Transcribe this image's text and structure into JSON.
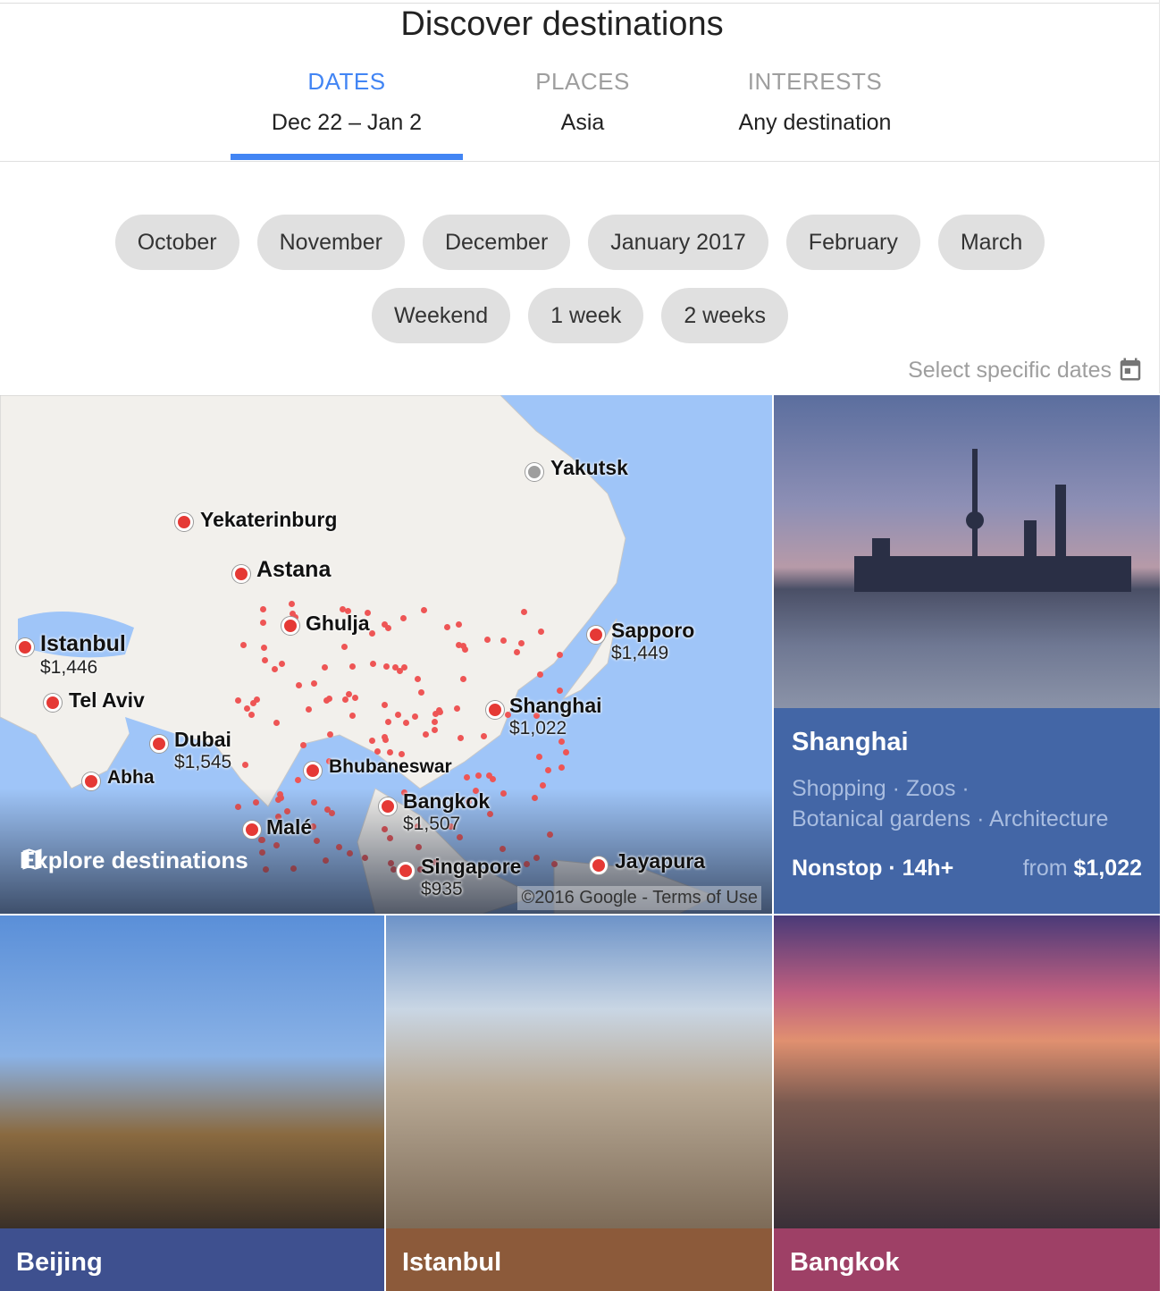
{
  "title": "Discover destinations",
  "tabs": [
    {
      "label": "DATES",
      "value": "Dec 22 – Jan 2",
      "active": true
    },
    {
      "label": "PLACES",
      "value": "Asia",
      "active": false
    },
    {
      "label": "INTERESTS",
      "value": "Any destination",
      "active": false
    }
  ],
  "months": [
    "October",
    "November",
    "December",
    "January 2017",
    "February",
    "March"
  ],
  "durations": [
    "Weekend",
    "1 week",
    "2 weeks"
  ],
  "select_dates": "Select specific dates",
  "map": {
    "pins": [
      {
        "name": "Yakutsk",
        "gray": true
      },
      {
        "name": "Yekaterinburg"
      },
      {
        "name": "Astana"
      },
      {
        "name": "Ghulja"
      },
      {
        "name": "Istanbul",
        "price": "$1,446"
      },
      {
        "name": "Sapporo",
        "price": "$1,449"
      },
      {
        "name": "Tel Aviv"
      },
      {
        "name": "Shanghai",
        "price": "$1,022"
      },
      {
        "name": "Dubai",
        "price": "$1,545"
      },
      {
        "name": "Bhubaneswar"
      },
      {
        "name": "Abha"
      },
      {
        "name": "Bangkok",
        "price": "$1,507"
      },
      {
        "name": "Malé"
      },
      {
        "name": "Singapore",
        "price": "$935"
      },
      {
        "name": "Jayapura"
      }
    ],
    "explore_label": "Explore destinations",
    "copyright": "©2016 Google - ",
    "terms": "Terms of Use"
  },
  "featured": {
    "name": "Shanghai",
    "tags_line1": "Shopping · Zoos ·",
    "tags_line2": "Botanical gardens · Architecture",
    "flight": "Nonstop · 14h+",
    "from": "from",
    "price": "$1,022",
    "color": "#4366a6"
  },
  "cards": [
    {
      "name": "Beijing",
      "color": "#3e508f"
    },
    {
      "name": "Istanbul",
      "color": "#8c5a3a"
    },
    {
      "name": "Bangkok",
      "color": "#9e4066"
    }
  ],
  "colors": {
    "accent": "#4285f4",
    "chip": "#e0e0e0",
    "pin": "#e53935"
  }
}
